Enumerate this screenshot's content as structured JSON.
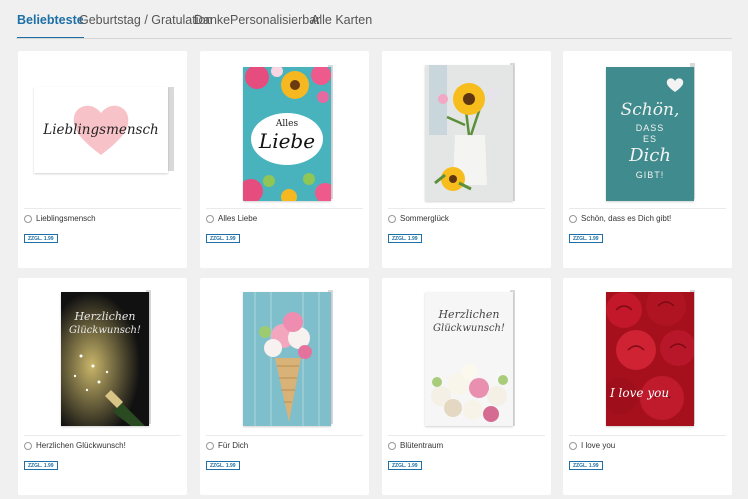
{
  "tabs": [
    {
      "label": "Beliebteste"
    },
    {
      "label": "Geburtstag / Gratulation"
    },
    {
      "label": "Danke"
    },
    {
      "label": "Personalisierbar"
    },
    {
      "label": "Alle Karten"
    }
  ],
  "cards": [
    {
      "title": "Lieblingsmensch",
      "price": "ZZGL. 1.99",
      "art": {
        "text": "Lieblingsmensch"
      }
    },
    {
      "title": "Alles Liebe",
      "price": "ZZGL. 1.99",
      "art": {
        "line1": "Alles",
        "line2": "Liebe"
      }
    },
    {
      "title": "Sommerglück",
      "price": "ZZGL. 1.99",
      "art": {}
    },
    {
      "title": "Schön, dass es Dich gibt!",
      "price": "ZZGL. 1.99",
      "art": {
        "line1": "Schön,",
        "line2": "DASS",
        "line3": "ES",
        "line4": "Dich",
        "line5": "GIBT!"
      }
    },
    {
      "title": "Herzlichen Glückwunsch!",
      "price": "ZZGL. 1.99",
      "art": {
        "line1": "Herzlichen",
        "line2": "Glückwunsch!"
      }
    },
    {
      "title": "Für Dich",
      "price": "ZZGL. 1.99",
      "art": {}
    },
    {
      "title": "Blütentraum",
      "price": "ZZGL. 1.99",
      "art": {
        "line1": "Herzlichen",
        "line2": "Glückwunsch!"
      }
    },
    {
      "title": "I love you",
      "price": "ZZGL. 1.99",
      "art": {
        "text": "I love you"
      }
    }
  ],
  "colors": {
    "accent": "#1d6fa5",
    "background": "#f0f0f0",
    "card": "#ffffff"
  }
}
